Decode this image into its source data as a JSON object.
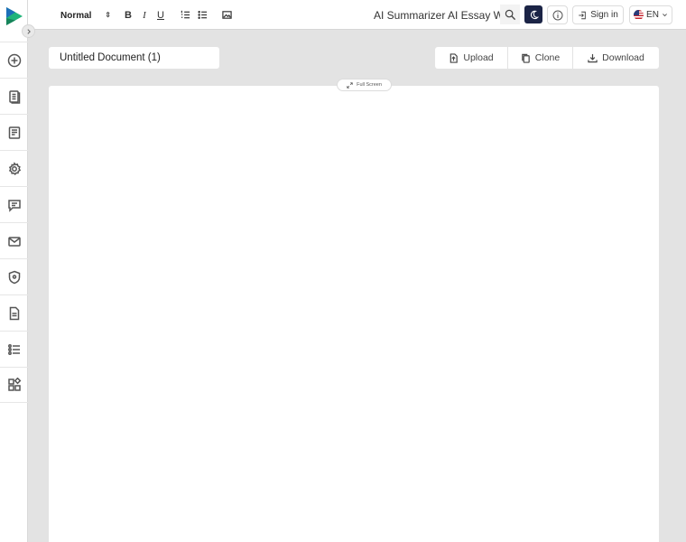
{
  "toolbar": {
    "format_value": "Normal",
    "bold": "B",
    "italic": "I",
    "underline": "U"
  },
  "nav": {
    "summarizer": "AI Summarizer",
    "essay": "AI Essay Writer"
  },
  "header": {
    "sign_in": "Sign in",
    "language": "EN"
  },
  "document": {
    "title": "Untitled Document (1)",
    "upload": "Upload",
    "clone": "Clone",
    "download": "Download",
    "fullscreen": "Full Screen"
  },
  "sidebar": {
    "items": [
      "add-icon",
      "documents-icon",
      "notes-icon",
      "settings-icon",
      "chat-icon",
      "email-icon",
      "shield-icon",
      "file-icon",
      "checklist-icon",
      "apps-icon"
    ]
  },
  "colors": {
    "brand_green": "#1fb47a",
    "brand_blue": "#1d6fb8",
    "theme_button": "#1b2446",
    "background": "#e3e3e3"
  }
}
